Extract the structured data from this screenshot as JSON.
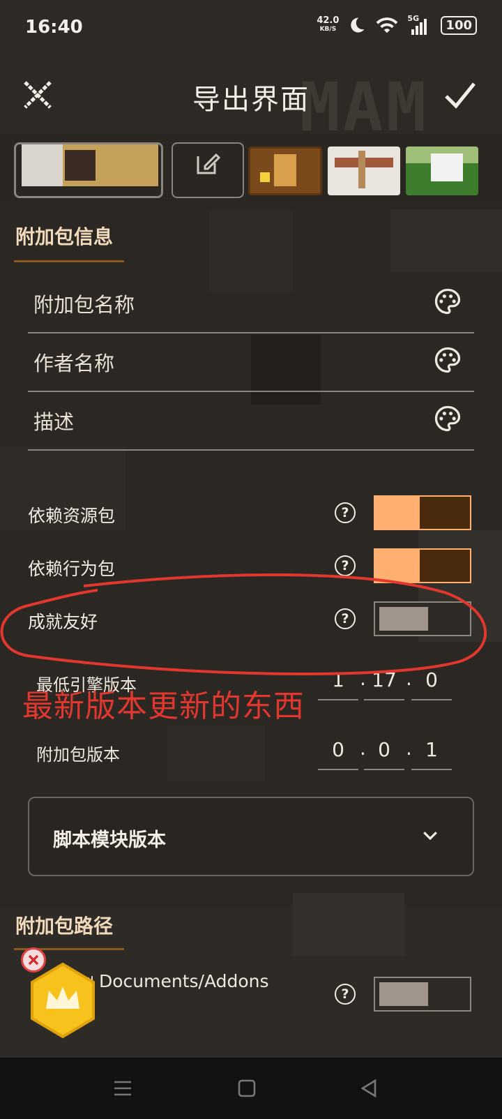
{
  "status_bar": {
    "time": "16:40",
    "net_speed": "42.0",
    "net_unit": "KB/S",
    "signal_label": "5G",
    "battery": "100"
  },
  "header": {
    "title": "导出界面",
    "watermark": "MAM",
    "close_icon": "close-icon",
    "confirm_icon": "check-icon"
  },
  "addon_info": {
    "section_title": "附加包信息",
    "fields": [
      {
        "label": "附加包名称"
      },
      {
        "label": "作者名称"
      },
      {
        "label": "描述"
      }
    ]
  },
  "toggles": [
    {
      "label": "依赖资源包",
      "on": true
    },
    {
      "label": "依赖行为包",
      "on": true
    },
    {
      "label": "成就友好",
      "on": false
    }
  ],
  "engine_version": {
    "label": "最低引擎版本",
    "major": "1",
    "minor": "17",
    "patch": "0"
  },
  "addon_version": {
    "label": "附加包版本",
    "major": "0",
    "minor": "0",
    "patch": "1"
  },
  "script_module": {
    "label": "脚本模块版本"
  },
  "addon_path": {
    "section_title": "附加包路径",
    "path_text": "Documents/Addons",
    "path_prefix_partial": "复制到",
    "toggle_on": false
  },
  "annotation": {
    "text": "最新版本更新的东西"
  },
  "colors": {
    "accent": "#ffb071",
    "knob_on": "#4a2a0c",
    "underline": "#8a5a1e",
    "annotation_red": "#e2372f"
  }
}
